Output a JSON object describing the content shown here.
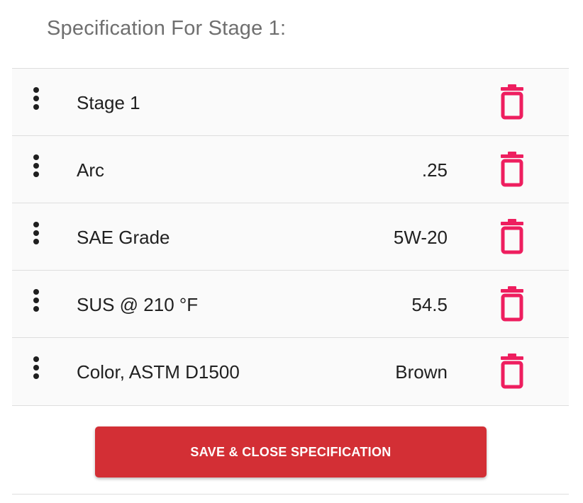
{
  "title": "Specification For Stage 1:",
  "rows": [
    {
      "label": "Stage 1",
      "value": ""
    },
    {
      "label": "Arc",
      "value": ".25"
    },
    {
      "label": "SAE Grade",
      "value": "5W-20"
    },
    {
      "label": "SUS @ 210 °F",
      "value": "54.5"
    },
    {
      "label": "Color, ASTM D1500",
      "value": "Brown"
    }
  ],
  "icons": {
    "drag": "drag-handle-icon",
    "delete": "trash-icon"
  },
  "colors": {
    "delete_icon": "#ee1e5f",
    "save_button": "#d32f35",
    "title": "#6f6f6f"
  },
  "save_button_label": "SAVE & CLOSE SPECIFICATION"
}
